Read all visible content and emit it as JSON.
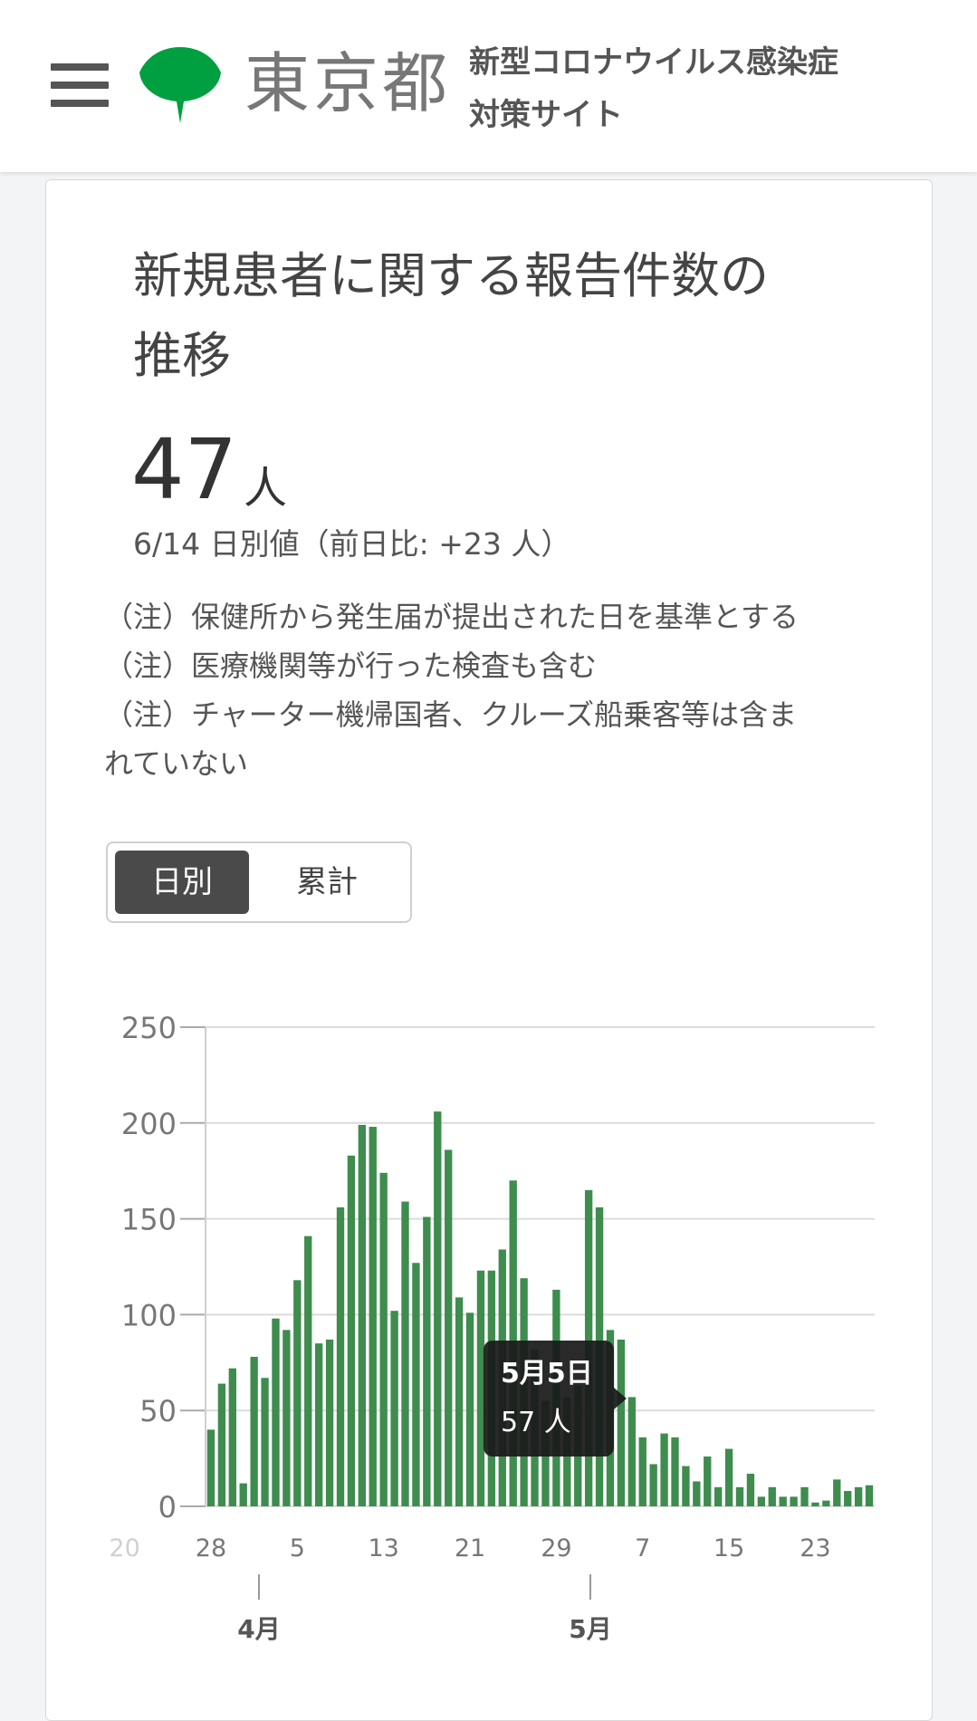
{
  "header": {
    "logo_text": "東京都",
    "site_title_line1": "新型コロナウイルス感染症",
    "site_title_line2": "対策サイト"
  },
  "card": {
    "title_line1": "新規患者に関する報告件数の",
    "title_line2": "推移",
    "value": "47",
    "unit": "人",
    "subtitle": "6/14 日別値（前日比: +23 人）",
    "notes": [
      "（注）保健所から発生届が提出された日を基準とする",
      "（注）医療機関等が行った検査も含む",
      "（注）チャーター機帰国者、クルーズ船乗客等は含ま",
      "れていない"
    ],
    "toggle": {
      "daily": "日別",
      "cumulative": "累計"
    }
  },
  "colors": {
    "bar": "#3e8c4e",
    "brand_green": "#00a040",
    "tooltip_bg": "#1a1a1a"
  },
  "chart_data": {
    "type": "bar",
    "ylim": [
      0,
      250
    ],
    "y_ticks": [
      "250",
      "200",
      "150",
      "100",
      "50",
      "0"
    ],
    "x_tick_labels": [
      "20",
      "28",
      "5",
      "13",
      "21",
      "29",
      "7",
      "15",
      "23"
    ],
    "month_labels": [
      "4月",
      "5月"
    ],
    "tooltip": {
      "date": "5月5日",
      "value": "57 人"
    },
    "values": [
      40,
      64,
      72,
      12,
      78,
      67,
      98,
      92,
      118,
      141,
      85,
      87,
      156,
      183,
      199,
      198,
      174,
      102,
      159,
      127,
      151,
      206,
      186,
      109,
      101,
      123,
      123,
      134,
      170,
      119,
      82,
      55,
      113,
      57,
      63,
      165,
      156,
      92,
      87,
      57,
      36,
      22,
      38,
      36,
      21,
      13,
      26,
      10,
      30,
      10,
      17,
      5,
      10,
      5,
      5,
      10,
      2,
      3,
      14,
      8,
      10,
      11
    ]
  }
}
